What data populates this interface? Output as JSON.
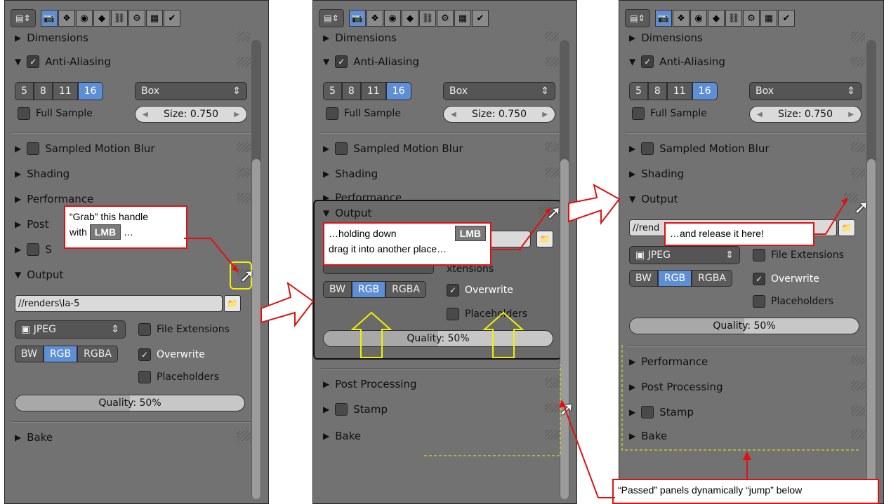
{
  "common": {
    "panels": {
      "dimensions": "Dimensions",
      "anti_aliasing": "Anti-Aliasing",
      "sampled_motion_blur": "Sampled Motion Blur",
      "shading": "Shading",
      "performance": "Performance",
      "post_processing": "Post Processing",
      "stamp": "Stamp",
      "output": "Output",
      "bake": "Bake"
    },
    "aa_samples": [
      "5",
      "8",
      "11",
      "16"
    ],
    "aa_selected": "16",
    "filter": "Box",
    "full_sample": "Full Sample",
    "size_field": "Size: 0.750",
    "output_path": "//renders\\la-5",
    "output_path_short": "//rend",
    "format": "JPEG",
    "file_extensions": "File Extensions",
    "file_extensions_cut": "xtensions",
    "color_modes": [
      "BW",
      "RGB",
      "RGBA"
    ],
    "color_selected": "RGB",
    "overwrite": "Overwrite",
    "placeholders": "Placeholders",
    "quality": "Quality: 50%",
    "quality_value": 0.5,
    "toolbar_icons": [
      "render-icon",
      "layers-icon",
      "world-icon",
      "object-icon",
      "constraint-icon",
      "modifier-icon",
      "texture-icon",
      "check-icon"
    ]
  },
  "callouts": {
    "grab_line1": "“Grab” this handle",
    "grab_line2": "with",
    "grab_key": "LMB",
    "grab_end": "…",
    "hold_line1a": "…holding down",
    "hold_key": "LMB",
    "hold_line2": "drag it into another place…",
    "release": "…and release it here!",
    "passed": "“Passed” panels dynamically “jump” below"
  },
  "colors": {
    "accent": "#5e8ed6",
    "callout_border": "#e21111",
    "highlight": "#f2f200"
  }
}
